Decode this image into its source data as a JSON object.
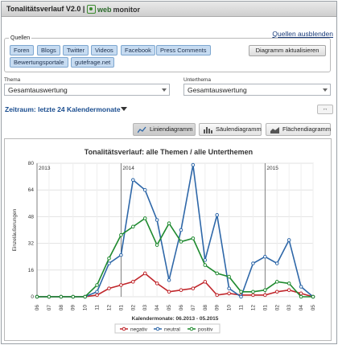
{
  "window": {
    "title": "Tonalitätsverlauf V2.0 |",
    "brand_part1": "web",
    "brand_part2": "monitor"
  },
  "quellen_hide_link": "Quellen ausblenden",
  "quellen": {
    "legend": "Quellen",
    "sources": [
      "Foren",
      "Blogs",
      "Twitter",
      "Videos",
      "Facebook",
      "Press Comments",
      "Bewertungsportale",
      "gutefrage.net"
    ],
    "update_button": "Diagramm aktualisieren"
  },
  "filters": {
    "thema_label": "Thema",
    "thema_value": "Gesamtauswertung",
    "unterthema_label": "Unterthema",
    "unterthema_value": "Gesamtauswertung"
  },
  "zeitraum": "Zeitraum: letzte 24 Kalendermonate",
  "expand_label": "↔",
  "tabs": [
    "Liniendiagramm",
    "Säulendiagramm",
    "Flächendiagramm"
  ],
  "colors": {
    "negativ": "#c0262b",
    "neutral": "#2e67a8",
    "positiv": "#1f8a2f",
    "source_bg": "#c6dbf1"
  },
  "chart_data": {
    "type": "line",
    "title": "Tonalitätsverlauf: alle Themen / alle Unterthemen",
    "xlabel": "Kalendermonate: 06.2013 - 05.2015",
    "ylabel": "Einzeläußerungen",
    "ylim": [
      0,
      80
    ],
    "yticks": [
      0,
      16,
      32,
      48,
      64,
      80
    ],
    "categories": [
      "06",
      "07",
      "08",
      "09",
      "10",
      "11",
      "12",
      "01",
      "02",
      "03",
      "04",
      "05",
      "06",
      "07",
      "08",
      "09",
      "10",
      "11",
      "12",
      "01",
      "02",
      "03",
      "04",
      "05"
    ],
    "year_markers": [
      {
        "label": "2013",
        "at_index": 0
      },
      {
        "label": "2014",
        "at_index": 7
      },
      {
        "label": "2015",
        "at_index": 19
      }
    ],
    "series": [
      {
        "name": "negativ",
        "values": [
          0,
          0,
          0,
          0,
          0,
          1,
          5,
          7,
          9,
          14,
          8,
          3,
          4,
          5,
          9,
          1,
          2,
          1,
          1,
          1,
          3,
          4,
          2,
          0
        ]
      },
      {
        "name": "neutral",
        "values": [
          0,
          0,
          0,
          0,
          0,
          3,
          20,
          25,
          70,
          64,
          46,
          10,
          40,
          79,
          22,
          49,
          5,
          0,
          20,
          24,
          20,
          34,
          6,
          0
        ]
      },
      {
        "name": "positiv",
        "values": [
          0,
          0,
          0,
          0,
          0,
          7,
          23,
          37,
          42,
          47,
          31,
          44,
          33,
          35,
          19,
          14,
          12,
          3,
          3,
          4,
          9,
          8,
          0,
          0
        ]
      }
    ],
    "legend": [
      "negativ",
      "neutral",
      "positiv"
    ],
    "legend_position": "bottom"
  }
}
